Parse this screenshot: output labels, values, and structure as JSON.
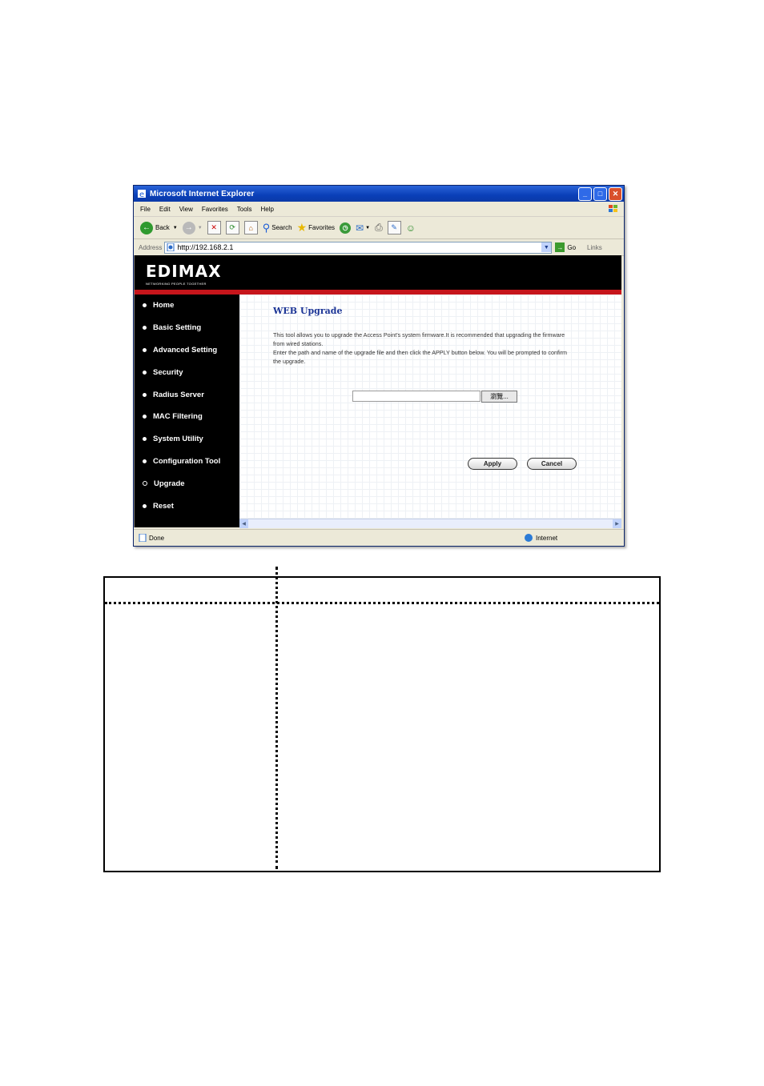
{
  "window": {
    "title": "Microsoft Internet Explorer",
    "menu": [
      "File",
      "Edit",
      "View",
      "Favorites",
      "Tools",
      "Help"
    ],
    "toolbar": {
      "back": "Back",
      "search": "Search",
      "favorites": "Favorites"
    },
    "address": {
      "label": "Address",
      "url": "http://192.168.2.1",
      "go": "Go",
      "links": "Links"
    },
    "status": {
      "left": "Done",
      "zone": "Internet"
    }
  },
  "brand": {
    "logo": "EDIMAX",
    "tagline": "NETWORKING PEOPLE TOGETHER"
  },
  "sidebar": {
    "items": [
      {
        "label": "Home"
      },
      {
        "label": "Basic Setting"
      },
      {
        "label": "Advanced Setting"
      },
      {
        "label": "Security"
      },
      {
        "label": "Radius Server"
      },
      {
        "label": "MAC Filtering"
      },
      {
        "label": "System Utility"
      },
      {
        "label": "Configuration Tool"
      },
      {
        "label": "Upgrade"
      },
      {
        "label": "Reset"
      }
    ]
  },
  "main": {
    "title": "WEB Upgrade",
    "desc1": "This tool allows you to upgrade the Access Point's system firmware.It is recommended that upgrading the firmware from wired stations.",
    "desc2": "Enter the path and name of the upgrade file and then click the APPLY button below. You will be prompted to confirm the upgrade.",
    "browse": "瀏覽...",
    "apply": "Apply",
    "cancel": "Cancel"
  }
}
